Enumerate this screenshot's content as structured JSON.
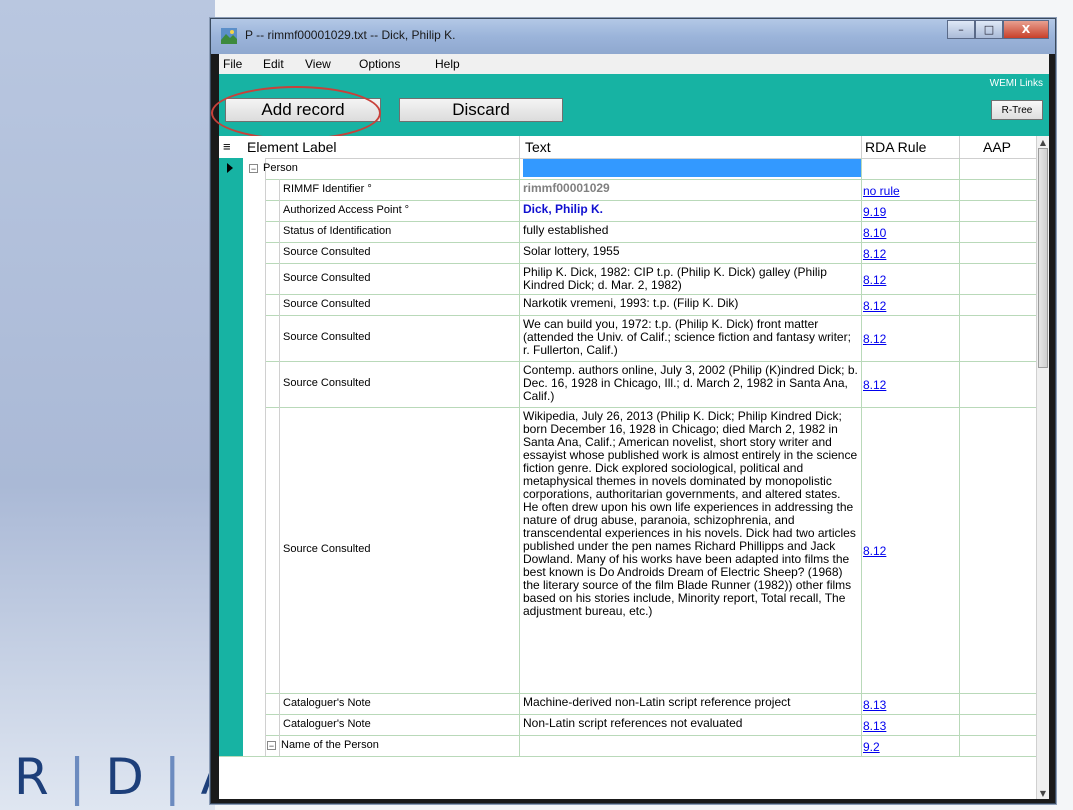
{
  "window": {
    "title": "P -- rimmf00001029.txt -- Dick, Philip K.",
    "buttons": {
      "minimize": "–",
      "maximize": "□",
      "close": "X"
    }
  },
  "menu": [
    "File",
    "Edit",
    "View",
    "Options",
    "Help"
  ],
  "toolbar": {
    "add_record": "Add record",
    "discard": "Discard",
    "wemi_links": "WEMI Links",
    "rtree": "R-Tree"
  },
  "grid": {
    "columns": [
      "Element Label",
      "Text",
      "RDA Rule",
      "AAP"
    ],
    "rows": [
      {
        "label": "Person",
        "text": "",
        "rule": "",
        "kind": "group"
      },
      {
        "label": "RIMMF Identifier °",
        "text": "rimmf00001029",
        "rule": "no rule",
        "kind": "gray-bold"
      },
      {
        "label": "Authorized Access Point °",
        "text": "Dick, Philip K.",
        "rule": "9.19",
        "kind": "blue-bold"
      },
      {
        "label": "Status of Identification",
        "text": "fully established",
        "rule": "8.10",
        "kind": "normal"
      },
      {
        "label": "Source Consulted",
        "text": "Solar lottery, 1955",
        "rule": "8.12",
        "kind": "normal"
      },
      {
        "label": "Source Consulted",
        "text": "Philip K. Dick, 1982: CIP t.p. (Philip K. Dick) galley (Philip Kindred Dick; d. Mar. 2, 1982)",
        "rule": "8.12",
        "kind": "normal"
      },
      {
        "label": "Source Consulted",
        "text": "Narkotik vremeni, 1993: t.p. (Filip K. Dik)",
        "rule": "8.12",
        "kind": "normal"
      },
      {
        "label": "Source Consulted",
        "text": "We can build you, 1972: t.p. (Philip K. Dick) front matter (attended the Univ. of Calif.; science fiction and fantasy writer; r. Fullerton, Calif.)",
        "rule": "8.12",
        "kind": "normal"
      },
      {
        "label": "Source Consulted",
        "text": "Contemp. authors online, July 3, 2002 (Philip (K)indred Dick; b. Dec. 16, 1928 in Chicago, Ill.; d. March 2, 1982 in Santa Ana, Calif.)",
        "rule": "8.12",
        "kind": "normal"
      },
      {
        "label": "Source Consulted",
        "text": "Wikipedia, July 26, 2013 (Philip K. Dick; Philip Kindred Dick; born December 16, 1928 in Chicago; died March 2, 1982 in Santa Ana, Calif.; American novelist, short story writer and essayist whose published work is almost entirely in the science fiction genre. Dick explored sociological, political and metaphysical themes in novels dominated by monopolistic corporations, authoritarian governments, and altered states. He often drew upon his own life experiences in addressing the nature of drug abuse, paranoia, schizophrenia, and transcendental experiences in his novels. Dick had two articles published under the pen names Richard Phillipps and Jack Dowland. Many of his works have been adapted into films the best known is Do Androids Dream of Electric Sheep? (1968) the literary source of the film Blade Runner (1982)) other films based on his stories include, Minority report, Total recall, The adjustment bureau, etc.)",
        "rule": "8.12",
        "kind": "normal"
      },
      {
        "label": "Cataloguer's Note",
        "text": "Machine-derived non-Latin script reference project",
        "rule": "8.13",
        "kind": "normal"
      },
      {
        "label": "Cataloguer's Note",
        "text": "Non-Latin script references not evaluated",
        "rule": "8.13",
        "kind": "normal"
      },
      {
        "label": "Name of the Person",
        "text": "",
        "rule": "9.2",
        "kind": "group2"
      }
    ]
  },
  "slide": {
    "logo_letters": [
      "R",
      "D",
      "A"
    ]
  },
  "colors": {
    "teal": "#17b3a3",
    "selection": "#3399ff",
    "link": "#0000ee",
    "highlight_oval": "#c8413a"
  }
}
